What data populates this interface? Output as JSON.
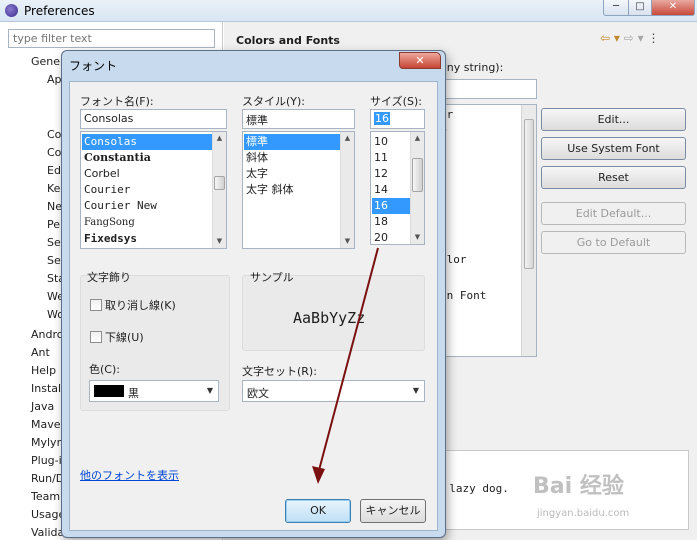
{
  "preferences": {
    "title": "Preferences",
    "filter_placeholder": "type filter text",
    "tree_items": [
      "Gener",
      "Ap",
      "Co",
      "Co",
      "Ed",
      "Ke",
      "Ne",
      "Pe",
      "Se",
      "Se",
      "Sta",
      "We",
      "Wo",
      "Andro",
      "Ant",
      "Help",
      "Install",
      "Java",
      "Maver",
      "Mylyn",
      "Plug-in",
      "Run/D",
      "Team",
      "Usage",
      "Valida"
    ],
    "page_title": "Colors and Fonts",
    "description_tail": "any string):",
    "list_fragments": [
      "or",
      "r",
      "olor",
      "on Font"
    ],
    "buttons": {
      "edit": "Edit...",
      "use_system_font": "Use System Font",
      "reset": "Reset",
      "edit_default": "Edit Default...",
      "go_to_default": "Go to Default"
    },
    "preview_text": "e lazy dog."
  },
  "font_dialog": {
    "title": "フォント",
    "font_name_label": "フォント名(F):",
    "font_name_value": "Consolas",
    "font_names": [
      "Consolas",
      "Constantia",
      "Corbel",
      "Courier",
      "Courier New",
      "FangSong",
      "Fixedsys"
    ],
    "style_label": "スタイル(Y):",
    "style_value": "標準",
    "styles": [
      "標準",
      "斜体",
      "太字",
      "太字 斜体"
    ],
    "size_label": "サイズ(S):",
    "size_value": "16",
    "sizes": [
      "10",
      "11",
      "12",
      "14",
      "16",
      "18",
      "20"
    ],
    "effects_label": "文字飾り",
    "strikeout_label": "取り消し線(K)",
    "underline_label": "下線(U)",
    "color_label": "色(C):",
    "color_value": "黒",
    "sample_label": "サンプル",
    "sample_text": "AaBbYyZz",
    "charset_label": "文字セット(R):",
    "charset_value": "欧文",
    "more_fonts_link": "他のフォントを表示",
    "ok_label": "OK",
    "cancel_label": "キャンセル"
  },
  "watermark": {
    "brand": "Bai  经验",
    "sub": "jingyan.baidu.com"
  },
  "colors": {
    "selection": "#3399ff",
    "dialog_frame": "#c7daee",
    "annotation_arrow": "#7a1010",
    "link": "#0046d5"
  }
}
